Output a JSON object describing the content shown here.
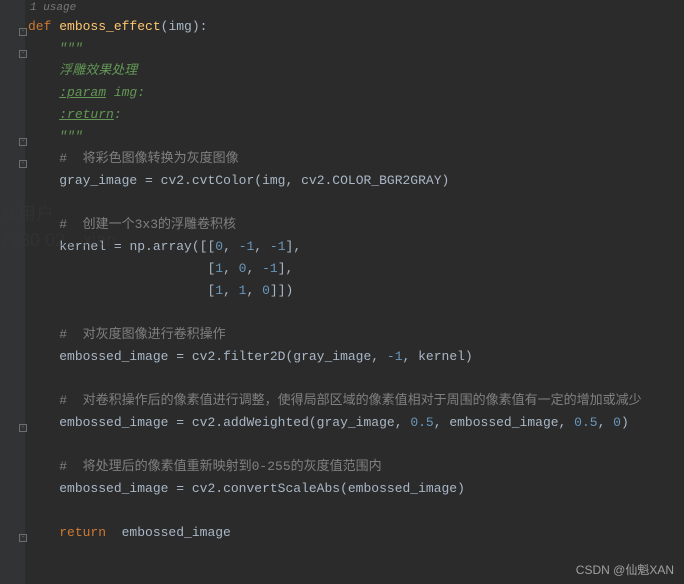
{
  "usage_hint": "1 usage",
  "code": {
    "l1": {
      "def": "def ",
      "fn": "emboss_effect",
      "lp": "(",
      "param": "img",
      "rp": "):",
      "indent": ""
    },
    "l2": {
      "indent": "    ",
      "txt": "\"\"\""
    },
    "l3": {
      "indent": "    ",
      "txt": "浮雕效果处理"
    },
    "l4": {
      "indent": "    ",
      "tag": ":param",
      "rest": " img:"
    },
    "l5": {
      "indent": "    ",
      "tag": ":return",
      "rest": ":"
    },
    "l6": {
      "indent": "    ",
      "txt": "\"\"\""
    },
    "l7": {
      "indent": "    ",
      "txt": "#  将彩色图像转换为灰度图像"
    },
    "l8": {
      "indent": "    ",
      "a": "gray_image ",
      "op": "= ",
      "b": "cv2.cvtColor(img",
      "c": ", ",
      "d": "cv2.COLOR_BGR2GRAY)"
    },
    "l9": {
      "indent": "    ",
      "txt": "#  创建一个3x3的浮雕卷积核"
    },
    "l10": {
      "indent": "    ",
      "a": "kernel ",
      "op": "= ",
      "b": "np.array([[",
      "n1": "0",
      "c1": ", ",
      "n2": "-1",
      "c2": ", ",
      "n3": "-1",
      "e": "],"
    },
    "l11": {
      "indent": "                       ",
      "lb": "[",
      "n1": "1",
      "c1": ", ",
      "n2": "0",
      "c2": ", ",
      "n3": "-1",
      "e": "],"
    },
    "l12": {
      "indent": "                       ",
      "lb": "[",
      "n1": "1",
      "c1": ", ",
      "n2": "1",
      "c2": ", ",
      "n3": "0",
      "e": "]])"
    },
    "l13": {
      "indent": "    ",
      "txt": "#  对灰度图像进行卷积操作"
    },
    "l14": {
      "indent": "    ",
      "a": "embossed_image ",
      "op": "= ",
      "b": "cv2.filter2D(gray_image",
      "c1": ", ",
      "n1": "-1",
      "c2": ", ",
      "d": "kernel)"
    },
    "l15": {
      "indent": "    ",
      "txt": "#  对卷积操作后的像素值进行调整，使得局部区域的像素值相对于周围的像素值有一定的增加或减少"
    },
    "l16": {
      "indent": "    ",
      "a": "embossed_image ",
      "op": "= ",
      "b": "cv2.addWeighted(gray_image",
      "c1": ", ",
      "n1": "0.5",
      "c2": ", ",
      "d": "embossed_image",
      "c3": ", ",
      "n2": "0.5",
      "c4": ", ",
      "n3": "0",
      "e": ")"
    },
    "l17": {
      "indent": "    ",
      "txt": "#  将处理后的像素值重新映射到0-255的灰度值范围内"
    },
    "l18": {
      "indent": "    ",
      "a": "embossed_image ",
      "op": "= ",
      "b": "cv2.convertScaleAbs(embossed_image)"
    },
    "l19": {
      "indent": "    ",
      "kw": "return ",
      "a": " embossed_image"
    }
  },
  "watermarks": {
    "bottom": "CSDN @仙魁XAN",
    "bg1": "从用户",
    "bg2": "7230 02，xian"
  },
  "fold_positions": [
    "28",
    "50",
    "138",
    "160",
    "424",
    "534"
  ]
}
